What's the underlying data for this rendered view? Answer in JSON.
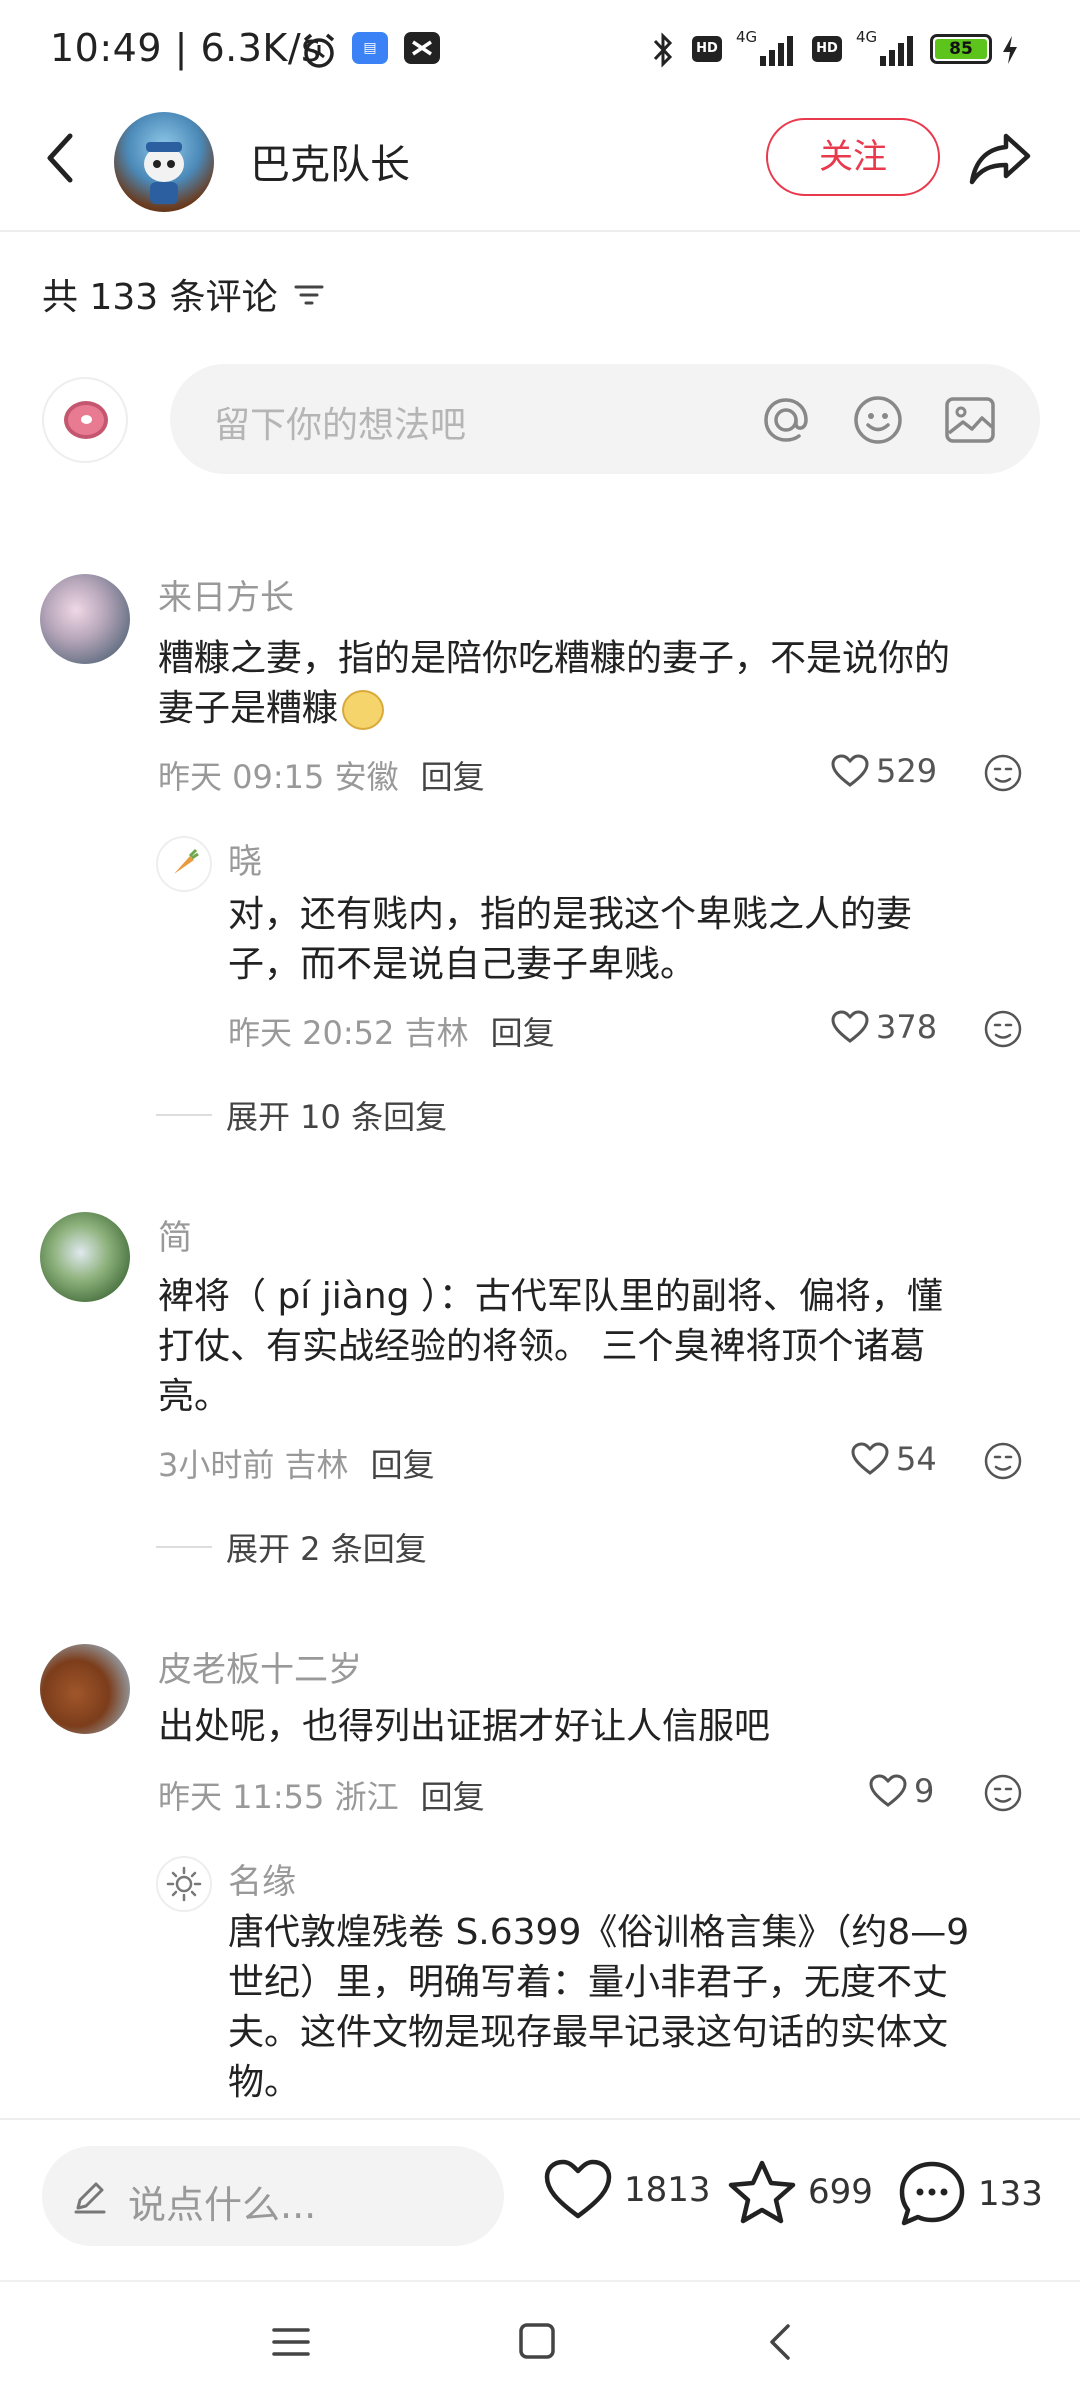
{
  "status_bar": {
    "time": "10:49",
    "speed": "6.3K/s",
    "battery": "85",
    "network": "4G",
    "hd": "HD"
  },
  "header": {
    "title": "巴克队长",
    "follow_label": "关注"
  },
  "comments_header": {
    "count_text": "共 133 条评论"
  },
  "comment_input": {
    "placeholder": "留下你的想法吧"
  },
  "comments": [
    {
      "name": "来日方长",
      "text_line1": "糟糠之妻，指的是陪你吃糟糠的妻子，不是说你的",
      "text_line2": "妻子是糟糠",
      "time": "昨天 09:15",
      "location": "安徽",
      "reply_label": "回复",
      "likes": "529",
      "sub_reply": {
        "name": "晓",
        "text_line1": "对，还有贱内，指的是我这个卑贱之人的妻",
        "text_line2": "子，而不是说自己妻子卑贱。",
        "time": "昨天 20:52",
        "location": "吉林",
        "reply_label": "回复",
        "likes": "378"
      },
      "expand_label": "展开 10 条回复"
    },
    {
      "name": "简",
      "text_line1": "裨将（ pí jiàng ）：古代军队里的副将、偏将，懂",
      "text_line2": "打仗、有实战经验的将领。 三个臭裨将顶个诸葛",
      "text_line3": "亮。",
      "time": "3小时前",
      "location": "吉林",
      "reply_label": "回复",
      "likes": "54",
      "expand_label": "展开 2 条回复"
    },
    {
      "name": "皮老板十二岁",
      "text_line1": "出处呢，也得列出证据才好让人信服吧",
      "time": "昨天 11:55",
      "location": "浙江",
      "reply_label": "回复",
      "likes": "9",
      "sub_reply": {
        "name": "名缘",
        "text_line1": "唐代敦煌残卷 S.6399《俗训格言集》（约8—9",
        "text_line2": "世纪）里，明确写着：量小非君子，无度不丈",
        "text_line3": "夫。这件文物是现存最早记录这句话的实体文",
        "text_line4": "物。"
      }
    }
  ],
  "bottom_bar": {
    "placeholder": "说点什么...",
    "likes": "1813",
    "stars": "699",
    "comments": "133"
  },
  "colors": {
    "accent": "#e8394d",
    "muted": "#999999",
    "text": "#222222",
    "input_bg": "#f3f3f3"
  }
}
